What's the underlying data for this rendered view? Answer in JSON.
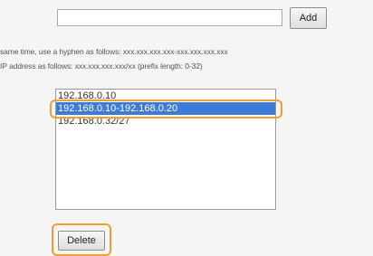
{
  "add_row": {
    "input_value": "",
    "add_label": "Add"
  },
  "hints": {
    "line1": "same time, use a hyphen as follows: xxx.xxx.xxx.xxx-xxx.xxx.xxx.xxx",
    "line2": "IP address as follows: xxx.xxx.xxx.xxx/xx (prefix length: 0-32)"
  },
  "address_list": {
    "items": [
      "192.168.0.10",
      "192.168.0.10-192.168.0.20",
      "192.168.0.32/27"
    ],
    "selected_index": 1
  },
  "delete_label": "Delete",
  "colors": {
    "highlight": "#f0a030",
    "selection": "#3d7bd9"
  }
}
